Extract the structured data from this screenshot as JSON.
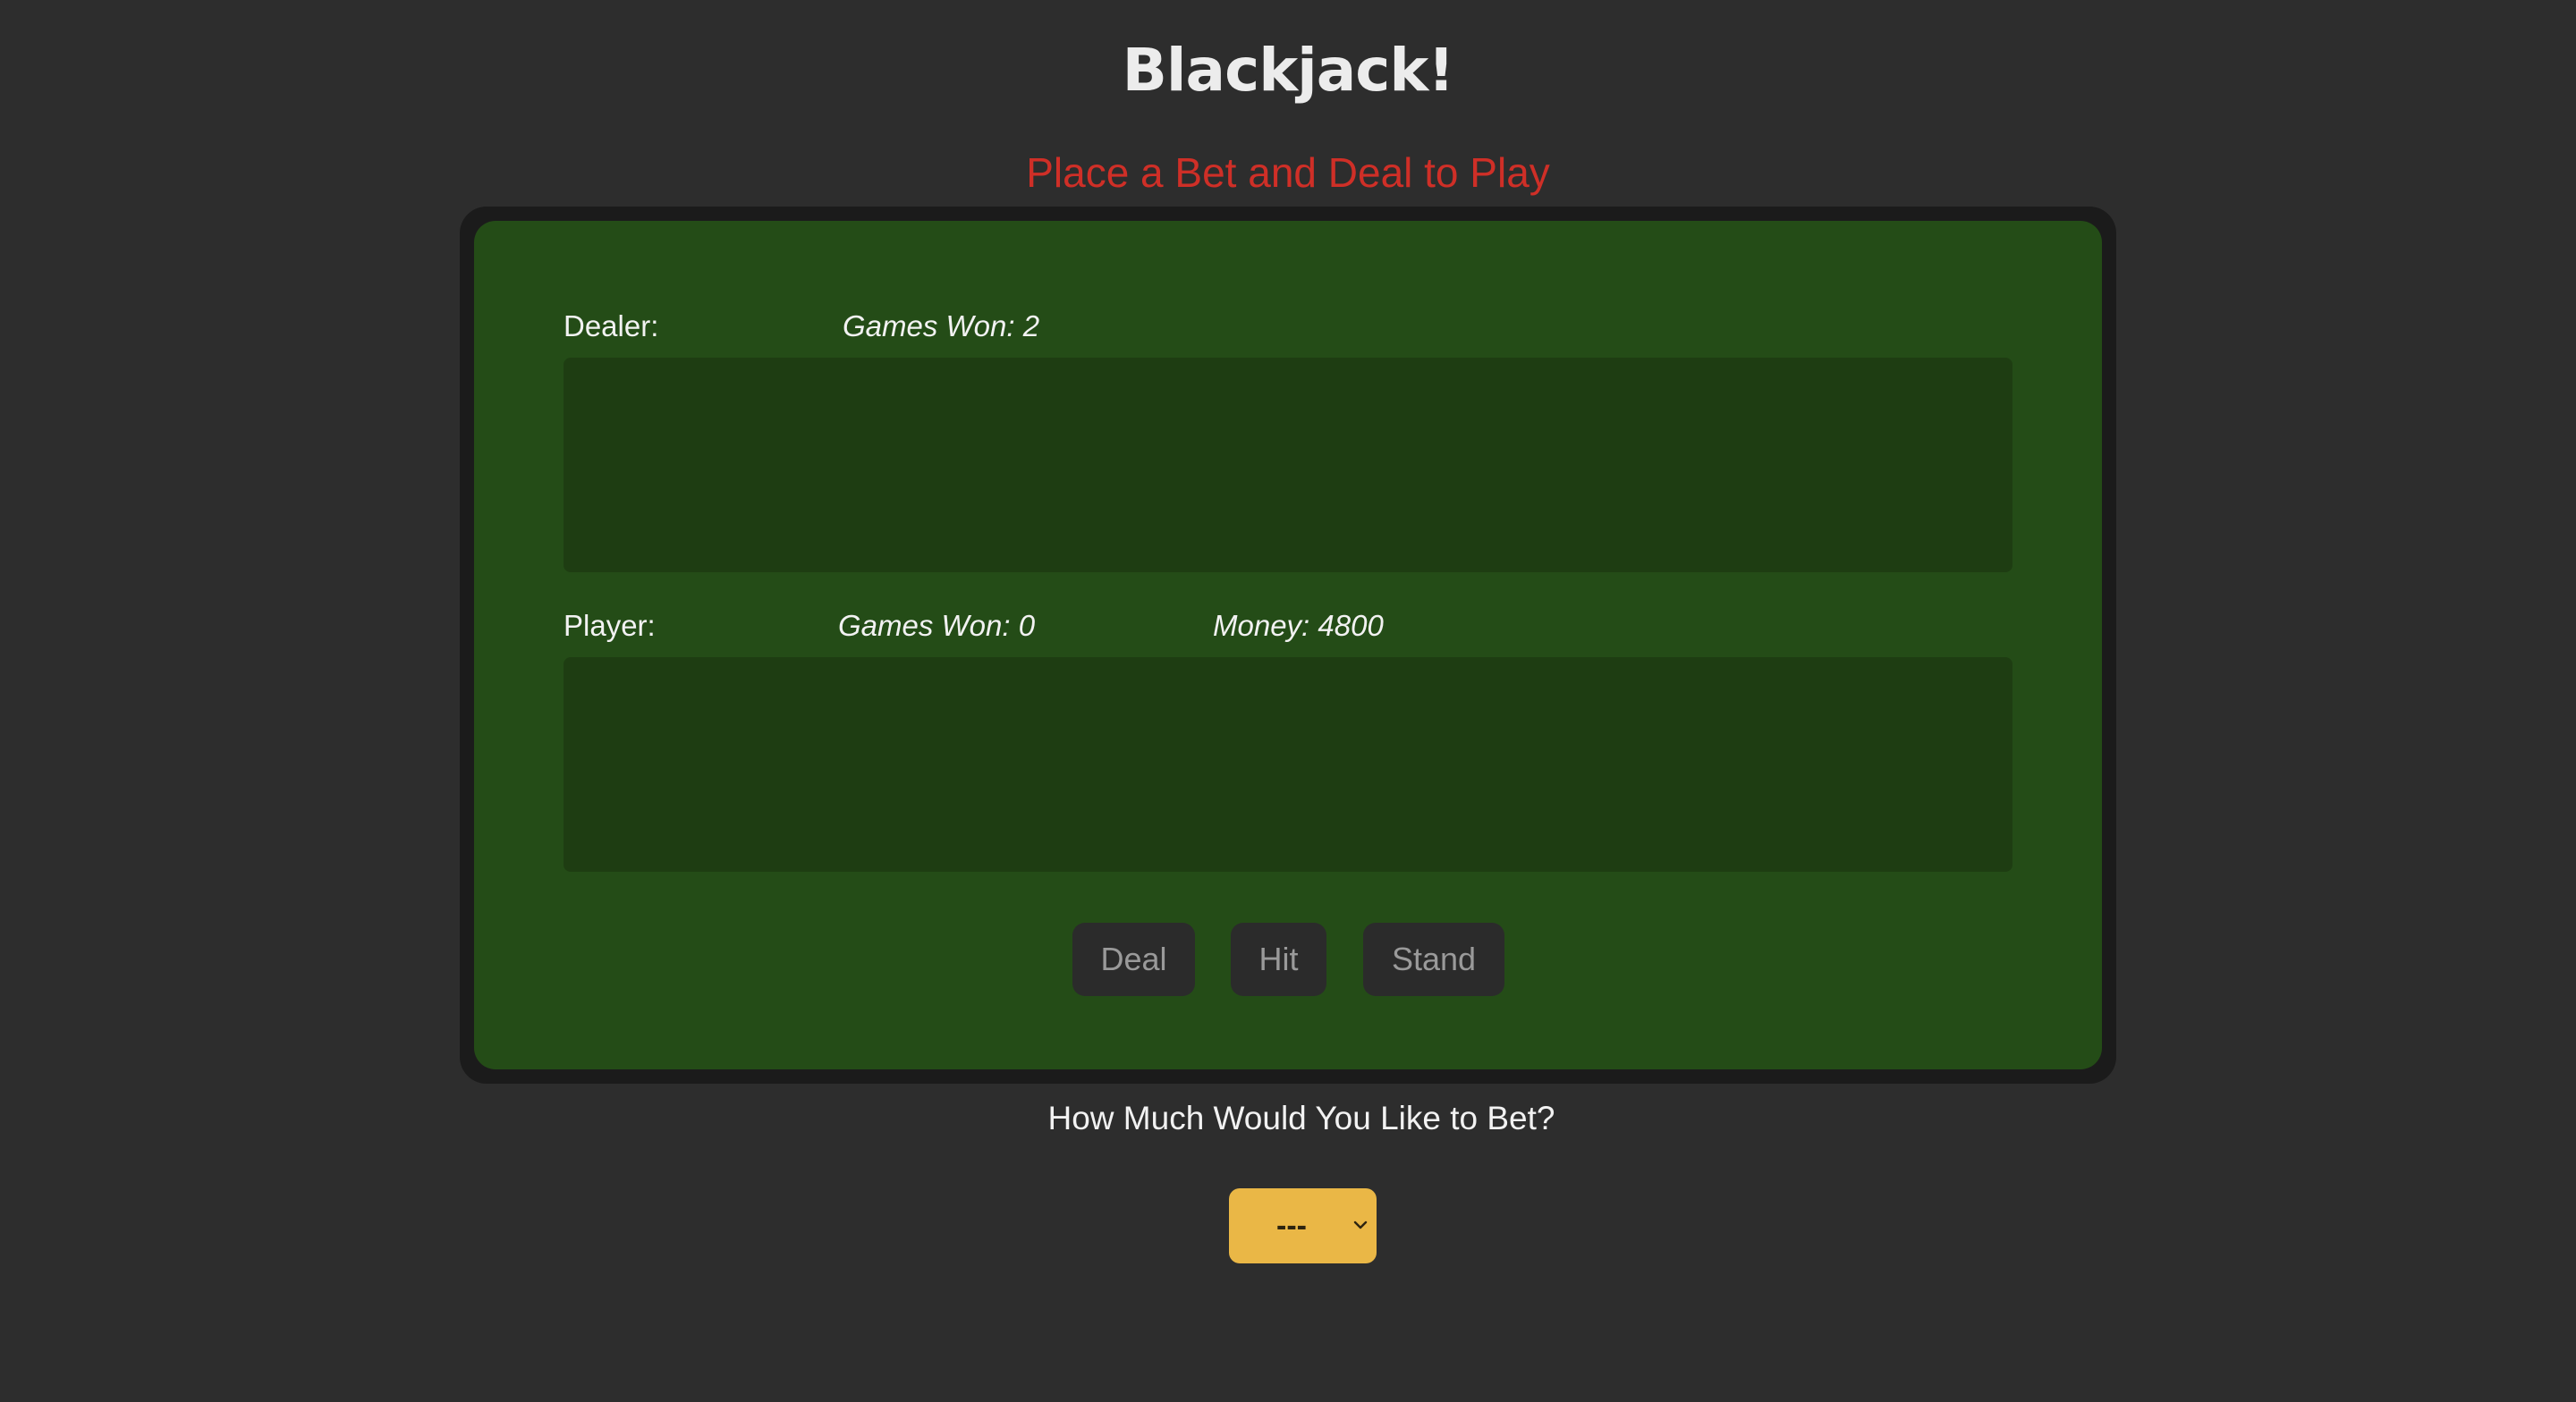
{
  "title": "Blackjack!",
  "status_message": "Place a Bet and Deal to Play",
  "dealer": {
    "label": "Dealer:",
    "games_won": "Games Won: 2"
  },
  "player": {
    "label": "Player:",
    "games_won": "Games Won: 0",
    "money": "Money: 4800"
  },
  "controls": {
    "deal_label": "Deal",
    "hit_label": "Hit",
    "stand_label": "Stand"
  },
  "bet": {
    "question": "How Much Would You Like to Bet?",
    "selected": "---"
  },
  "colors": {
    "background": "#2d2d2d",
    "felt": "#244c17",
    "status": "#cf2f27",
    "bet_select": "#eab746"
  },
  "icons": {
    "bet_dropdown": "chevron-down-icon"
  }
}
